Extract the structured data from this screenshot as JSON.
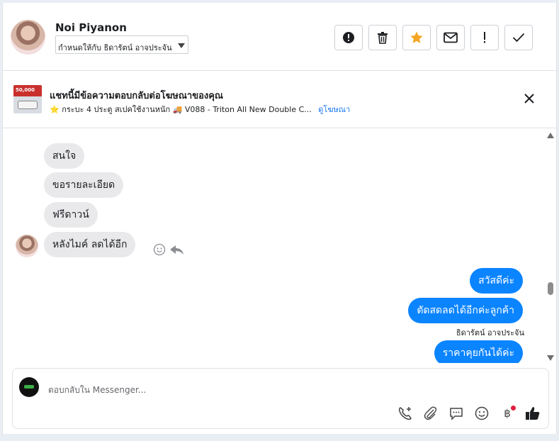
{
  "header": {
    "contact_name": "Noi Piyanon",
    "assign_value": "กำหนดให้กับ ธิดารัตน์ อาจประจัน",
    "actions": [
      {
        "name": "spam-button",
        "icon": "alert-circle-icon"
      },
      {
        "name": "delete-button",
        "icon": "trash-icon"
      },
      {
        "name": "star-button",
        "icon": "star-icon"
      },
      {
        "name": "mark-unread-button",
        "icon": "envelope-icon"
      },
      {
        "name": "follow-up-button",
        "icon": "exclamation-icon"
      },
      {
        "name": "done-button",
        "icon": "check-icon"
      }
    ]
  },
  "ad": {
    "thumb_text": "50,000",
    "title": "แชทนี้มีข้อความตอบกลับต่อโฆษณาของคุณ",
    "subtitle": "⭐ กระบะ 4 ประตู สเปคใช้งานหนัก 🚚 V088 - Triton All New Double C...",
    "link": "ดูโฆษณา"
  },
  "messages": {
    "incoming": [
      "สนใจ",
      "ขอรายละเอียด",
      "ฟรีดาวน์",
      "หลังไมค์ ลดได้อีก"
    ],
    "outgoing": [
      "สวัสดีค่ะ",
      "ตัดสดลดได้อีกค่ะลูกค้า",
      "ราคาคุยกันได้ค่ะ"
    ],
    "sender_label": "ธิดารัตน์ อาจประจัน"
  },
  "composer": {
    "placeholder": "ตอบกลับใน Messenger...",
    "baht_symbol": "฿",
    "tools": [
      "phone-plus-icon",
      "paperclip-icon",
      "chat-bubble-icon",
      "smiley-icon",
      "baht-icon",
      "thumbs-up-icon"
    ]
  },
  "colors": {
    "outgoing_bubble": "#0b84ff",
    "incoming_bubble": "#e9e9eb",
    "link": "#1876f2",
    "star": "#f5a623",
    "notification_dot": "#e41e3f"
  }
}
